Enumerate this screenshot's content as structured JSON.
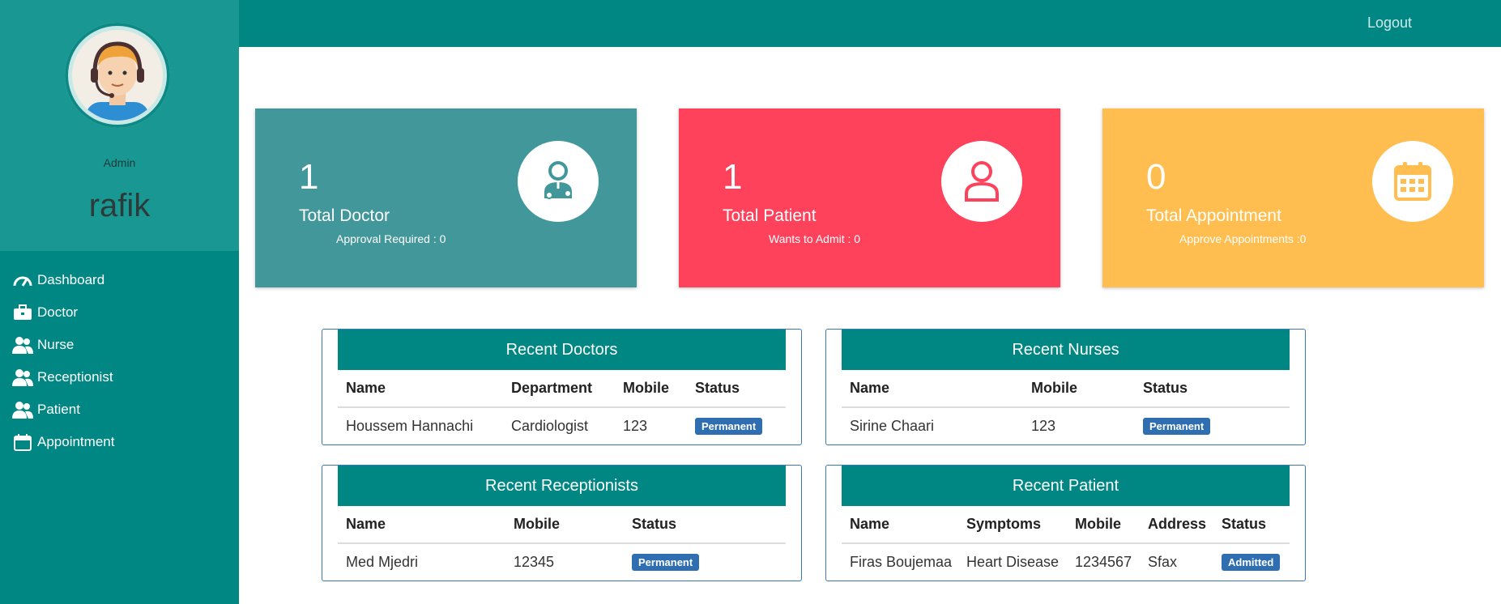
{
  "sidebar": {
    "role": "Admin",
    "username": "rafik",
    "items": [
      {
        "label": "Dashboard",
        "icon": "speedometer-icon"
      },
      {
        "label": "Doctor",
        "icon": "briefcase-icon"
      },
      {
        "label": "Nurse",
        "icon": "users-icon"
      },
      {
        "label": "Receptionist",
        "icon": "users-icon"
      },
      {
        "label": "Patient",
        "icon": "users-icon"
      },
      {
        "label": "Appointment",
        "icon": "calendar-icon"
      }
    ]
  },
  "topbar": {
    "logout_label": "Logout"
  },
  "cards": [
    {
      "count": "1",
      "label": "Total Doctor",
      "sub": "Approval Required : 0",
      "color": "#42979a",
      "icon": "doctor-icon"
    },
    {
      "count": "1",
      "label": "Total Patient",
      "sub": "Wants to Admit : 0",
      "color": "#ff425c",
      "icon": "user-icon"
    },
    {
      "count": "0",
      "label": "Total Appointment",
      "sub": "Approve Appointments :0",
      "color": "#ffbe4f",
      "icon": "calendar-icon"
    }
  ],
  "recent_doctors": {
    "title": "Recent Doctors",
    "headers": [
      "Name",
      "Department",
      "Mobile",
      "Status"
    ],
    "rows": [
      {
        "name": "Houssem Hannachi",
        "department": "Cardiologist",
        "mobile": "123",
        "status": "Permanent"
      }
    ]
  },
  "recent_nurses": {
    "title": "Recent Nurses",
    "headers": [
      "Name",
      "Mobile",
      "Status"
    ],
    "rows": [
      {
        "name": "Sirine Chaari",
        "mobile": "123",
        "status": "Permanent"
      }
    ]
  },
  "recent_receptionists": {
    "title": "Recent Receptionists",
    "headers": [
      "Name",
      "Mobile",
      "Status"
    ],
    "rows": [
      {
        "name": "Med Mjedri",
        "mobile": "12345",
        "status": "Permanent"
      }
    ]
  },
  "recent_patients": {
    "title": "Recent Patient",
    "headers": [
      "Name",
      "Symptoms",
      "Mobile",
      "Address",
      "Status"
    ],
    "rows": [
      {
        "name": "Firas Boujemaa",
        "symptoms": "Heart Disease",
        "mobile": "1234567",
        "address": "Sfax",
        "status": "Admitted"
      }
    ]
  },
  "colors": {
    "teal": "#008784",
    "badge": "#2f6fb1"
  }
}
